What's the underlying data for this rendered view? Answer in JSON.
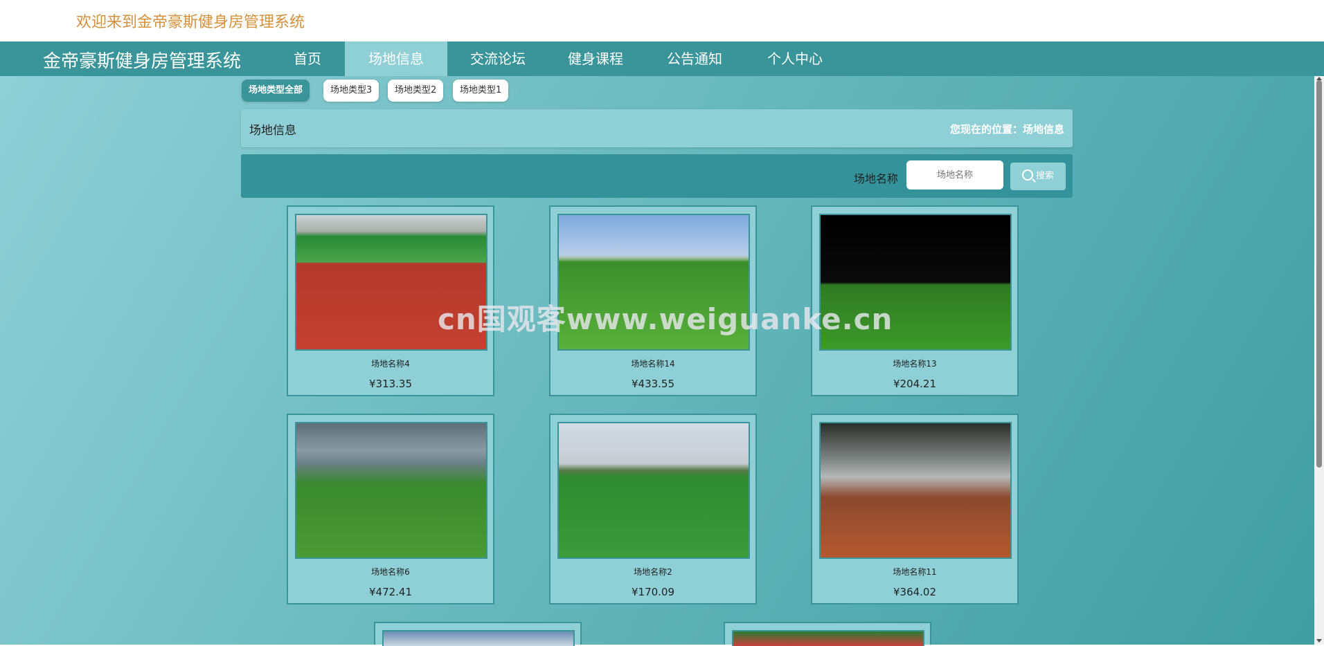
{
  "header": {
    "welcome": "欢迎来到金帝豪斯健身房管理系统",
    "brand": "金帝豪斯健身房管理系统"
  },
  "nav": {
    "items": [
      "首页",
      "场地信息",
      "交流论坛",
      "健身课程",
      "公告通知",
      "个人中心"
    ],
    "active_index": 1
  },
  "filters": [
    "场地类型全部",
    "场地类型3",
    "场地类型2",
    "场地类型1"
  ],
  "breadcrumb": {
    "title": "场地信息",
    "location": "您现在的位置：场地信息"
  },
  "search": {
    "label": "场地名称",
    "placeholder": "场地名称",
    "button": "搜索"
  },
  "venues": [
    {
      "name": "场地名称4",
      "price": "¥313.35",
      "image": "running-track-photo"
    },
    {
      "name": "场地名称14",
      "price": "¥433.55",
      "image": "soccer-field-photo"
    },
    {
      "name": "场地名称13",
      "price": "¥204.21",
      "image": "night-stadium-photo"
    },
    {
      "name": "场地名称6",
      "price": "¥472.41",
      "image": "arena-photo"
    },
    {
      "name": "场地名称2",
      "price": "¥170.09",
      "image": "school-field-photo"
    },
    {
      "name": "场地名称11",
      "price": "¥364.02",
      "image": "tennis-court-photo"
    }
  ],
  "watermark": "cn国观客www.weiguanke.cn",
  "colors": {
    "accent": "#3a959a",
    "light": "#8ed0d6",
    "welcome_text": "#d4913a"
  }
}
